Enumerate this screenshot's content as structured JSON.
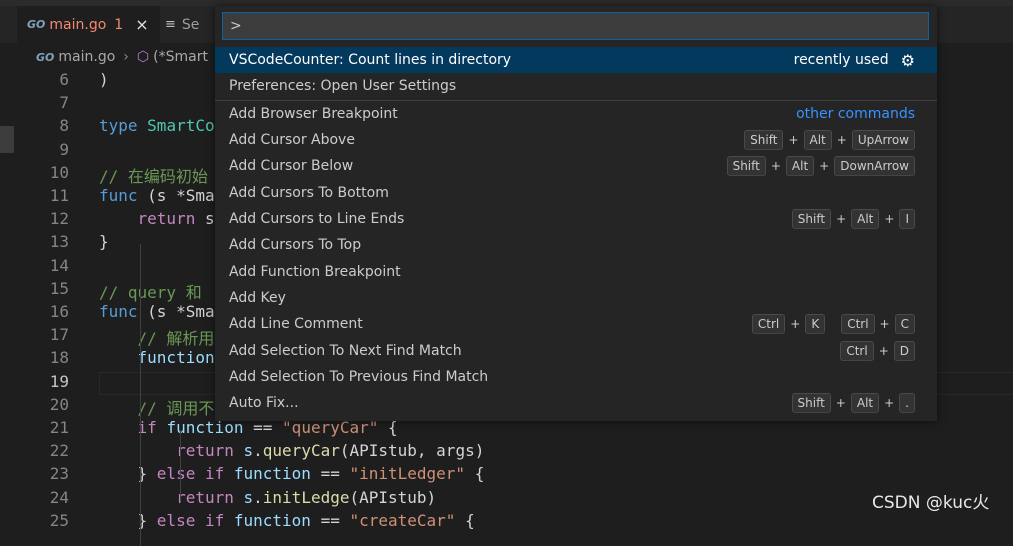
{
  "tabs": [
    {
      "icon": "GO",
      "label": "main.go",
      "modified": "1",
      "close": "×"
    },
    {
      "icon": "≡",
      "label": "Se"
    }
  ],
  "breadcrumb": {
    "icon": "GO",
    "file": "main.go",
    "separator": "›",
    "symbol_icon": "⬡",
    "symbol": "(*Smart"
  },
  "editor": {
    "lines": [
      {
        "n": "6",
        "tokens": [
          {
            "c": "tx",
            "t": ")"
          }
        ]
      },
      {
        "n": "7",
        "tokens": []
      },
      {
        "n": "8",
        "tokens": [
          {
            "c": "kw",
            "t": "type "
          },
          {
            "c": "ty",
            "t": "SmartCo"
          }
        ]
      },
      {
        "n": "9",
        "tokens": []
      },
      {
        "n": "10",
        "tokens": [
          {
            "c": "cm",
            "t": "// 在编码初始"
          }
        ]
      },
      {
        "n": "11",
        "tokens": [
          {
            "c": "kw",
            "t": "func "
          },
          {
            "c": "tx",
            "t": "(s *Sma"
          }
        ]
      },
      {
        "n": "12",
        "tokens": [
          {
            "c": "ctl",
            "t": "    return "
          },
          {
            "c": "tx",
            "t": "s"
          }
        ]
      },
      {
        "n": "13",
        "tokens": [
          {
            "c": "tx",
            "t": "}"
          }
        ]
      },
      {
        "n": "14",
        "tokens": []
      },
      {
        "n": "15",
        "tokens": [
          {
            "c": "cm",
            "t": "// query 和"
          }
        ]
      },
      {
        "n": "16",
        "tokens": [
          {
            "c": "kw",
            "t": "func "
          },
          {
            "c": "tx",
            "t": "(s *Sma"
          }
        ]
      },
      {
        "n": "17",
        "tokens": [
          {
            "c": "cm",
            "t": "    // 解析用"
          }
        ]
      },
      {
        "n": "18",
        "tokens": [
          {
            "c": "var",
            "t": "    function"
          }
        ]
      },
      {
        "n": "19",
        "tokens": [],
        "current": true
      },
      {
        "n": "20",
        "tokens": [
          {
            "c": "cm",
            "t": "    // 调用不"
          }
        ]
      },
      {
        "n": "21",
        "tokens": [
          {
            "c": "ctl",
            "t": "    if "
          },
          {
            "c": "var",
            "t": "function "
          },
          {
            "c": "tx",
            "t": "== "
          },
          {
            "c": "st",
            "t": "\"queryCar\""
          },
          {
            "c": "tx",
            "t": " {"
          }
        ]
      },
      {
        "n": "22",
        "tokens": [
          {
            "c": "ctl",
            "t": "        return "
          },
          {
            "c": "var",
            "t": "s"
          },
          {
            "c": "tx",
            "t": "."
          },
          {
            "c": "fn",
            "t": "queryCar"
          },
          {
            "c": "tx",
            "t": "(APIstub, args)"
          }
        ]
      },
      {
        "n": "23",
        "tokens": [
          {
            "c": "tx",
            "t": "    } "
          },
          {
            "c": "ctl",
            "t": "else if "
          },
          {
            "c": "var",
            "t": "function "
          },
          {
            "c": "tx",
            "t": "== "
          },
          {
            "c": "st",
            "t": "\"initLedger\""
          },
          {
            "c": "tx",
            "t": " {"
          }
        ]
      },
      {
        "n": "24",
        "tokens": [
          {
            "c": "ctl",
            "t": "        return "
          },
          {
            "c": "var",
            "t": "s"
          },
          {
            "c": "tx",
            "t": "."
          },
          {
            "c": "fn",
            "t": "initLedge"
          },
          {
            "c": "tx",
            "t": "(APIstub)"
          }
        ]
      },
      {
        "n": "25",
        "tokens": [
          {
            "c": "tx",
            "t": "    } "
          },
          {
            "c": "ctl",
            "t": "else if "
          },
          {
            "c": "var",
            "t": "function "
          },
          {
            "c": "tx",
            "t": "== "
          },
          {
            "c": "st",
            "t": "\"createCar\""
          },
          {
            "c": "tx",
            "t": " {"
          }
        ]
      }
    ]
  },
  "palette": {
    "input_value": ">",
    "items": [
      {
        "label": "VSCodeCounter: Count lines in directory",
        "note": "recently used",
        "gear": "⚙",
        "selected": true
      },
      {
        "label": "Preferences: Open User Settings"
      },
      {
        "label": "Add Browser Breakpoint",
        "note": "other commands"
      },
      {
        "label": "Add Cursor Above",
        "keys": [
          [
            "Shift",
            "Alt",
            "UpArrow"
          ]
        ]
      },
      {
        "label": "Add Cursor Below",
        "keys": [
          [
            "Shift",
            "Alt",
            "DownArrow"
          ]
        ]
      },
      {
        "label": "Add Cursors To Bottom"
      },
      {
        "label": "Add Cursors to Line Ends",
        "keys": [
          [
            "Shift",
            "Alt",
            "I"
          ]
        ]
      },
      {
        "label": "Add Cursors To Top"
      },
      {
        "label": "Add Function Breakpoint"
      },
      {
        "label": "Add Key"
      },
      {
        "label": "Add Line Comment",
        "keys": [
          [
            "Ctrl",
            "K"
          ],
          [
            "Ctrl",
            "C"
          ]
        ]
      },
      {
        "label": "Add Selection To Next Find Match",
        "keys": [
          [
            "Ctrl",
            "D"
          ]
        ]
      },
      {
        "label": "Add Selection To Previous Find Match"
      },
      {
        "label": "Auto Fix...",
        "keys": [
          [
            "Shift",
            "Alt",
            "."
          ]
        ]
      }
    ]
  },
  "watermark": "CSDN @kuc火"
}
